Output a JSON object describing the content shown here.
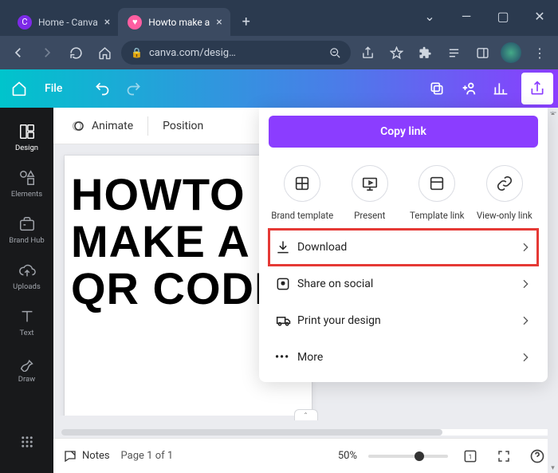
{
  "browser": {
    "tabs": [
      {
        "title": "Home - Canva",
        "active": false
      },
      {
        "title": "Howto make a",
        "active": true
      }
    ],
    "url_display": "canva.com/desig…"
  },
  "header": {
    "file_label": "File"
  },
  "sidebar": {
    "items": [
      {
        "label": "Design"
      },
      {
        "label": "Elements"
      },
      {
        "label": "Brand Hub"
      },
      {
        "label": "Uploads"
      },
      {
        "label": "Text"
      },
      {
        "label": "Draw"
      }
    ]
  },
  "toolbar": {
    "animate_label": "Animate",
    "position_label": "Position"
  },
  "canvas": {
    "page_text": "HOWTO MAKE A QR CODE"
  },
  "panel": {
    "copy_link_label": "Copy link",
    "icons": [
      {
        "label": "Brand template"
      },
      {
        "label": "Present"
      },
      {
        "label": "Template link"
      },
      {
        "label": "View-only link"
      }
    ],
    "rows": [
      {
        "label": "Download",
        "highlighted": true
      },
      {
        "label": "Share on social",
        "highlighted": false
      },
      {
        "label": "Print your design",
        "highlighted": false
      },
      {
        "label": "More",
        "highlighted": false
      }
    ]
  },
  "footer": {
    "notes_label": "Notes",
    "page_label": "Page 1 of 1",
    "zoom_label": "50%"
  }
}
